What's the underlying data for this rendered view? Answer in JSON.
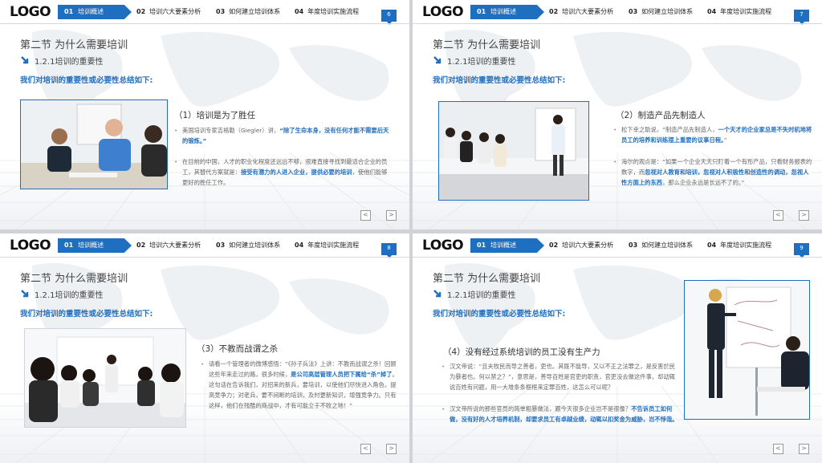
{
  "header": {
    "logo": "LOGO",
    "nav": [
      {
        "num": "01",
        "label": "培训概述"
      },
      {
        "num": "02",
        "label": "培训六大要素分析"
      },
      {
        "num": "03",
        "label": "如何建立培训体系"
      },
      {
        "num": "04",
        "label": "年度培训实施流程"
      }
    ]
  },
  "common": {
    "section_title": "第二节  为什么需要培训",
    "sub_heading": "1.2.1培训的重要性",
    "lead": "我们对培训的重要性或必要性总结如下:",
    "prev": "<",
    "next": ">"
  },
  "slides": [
    {
      "page": "6",
      "point_title": "（1）培训是为了胜任",
      "bullets": [
        {
          "pre": "美国培训专家吉格勒（Giegler）讲，",
          "hl": "“除了生命本身，没有任何才能不需要后天的锻炼。”",
          "post": ""
        },
        {
          "pre": "在目前的中国，人才的职业化程度还远远不够，很难直接寻找到最适合企业的员工，其替代方案就是：",
          "hl": "接受有潜力的人进入企业，提供必要的培训",
          "post": "，使他们能够更好的胜任工作。"
        }
      ]
    },
    {
      "page": "7",
      "point_title": "（2）制造产品先制造人",
      "bullets": [
        {
          "pre": "松下幸之助说，“制造产品先制造人，",
          "hl": "一个天才的企业家总是不失时机地将员工的培养和训练摆上重要的议事日程。",
          "post": "”"
        },
        {
          "pre": "海尔的观点是：“如果一个企业天天只盯着一个有形产品，只看财务报表的数字，而",
          "hl": "忽视对人教育和培训，忽视对人积极性和创造性的调动，忽视人性方面上的东西",
          "post": "，那么企业永远是长远不了的。”"
        }
      ]
    },
    {
      "page": "8",
      "point_title": "（3）不教而战谓之杀",
      "bullets": [
        {
          "pre": "请看一个管理者的微博感悟：“《孙子兵法》上讲：不教而战谓之杀！回顾这些年来走过的路，很多时候，",
          "hl": "是公司高层管理人员把下属给“杀”掉了",
          "post": "。这句话在告诉我们，对招来的新兵，要培训，以使他们尽快进入角色，提高竞争力；对老兵，要不间断的培训，及时更新知识，增强竞争力。只有这样，他们在残酷的商战中，才有可能立于不败之地！”"
        }
      ]
    },
    {
      "page": "9",
      "point_title": "（4）没有经过系统培训的员工没有生产力",
      "bullets": [
        {
          "pre": "汉文帝说：“且夫牧民而导之善者，吏也。其既不能导，又以不正之法罪之，是反害於民为暴者也。何以禁之？”，意思是，善导百姓是官吏的职责，官吏没去做这件事，却动辄说百姓有问题，用一大堆条条框框来定罪百姓，这怎么可以呢？",
          "hl": "",
          "post": ""
        },
        {
          "pre": "汉文帝所说的那些官员的简单粗暴做法，跟今天很多企业岂不是很像？",
          "hl": "不告诉员工如何做，没有好的人才培养机制，却要求员工有卓越业绩，动辄以扣奖金为威胁，岂不悖哉。",
          "post": ""
        }
      ]
    }
  ]
}
